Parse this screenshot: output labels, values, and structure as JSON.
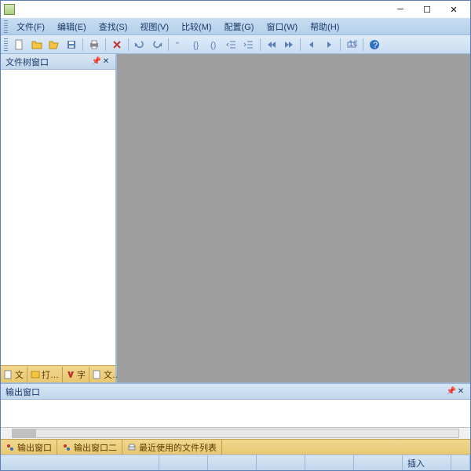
{
  "menus": {
    "file": "文件(F)",
    "edit": "编辑(E)",
    "search": "查找(S)",
    "view": "视图(V)",
    "compare": "比较(M)",
    "config": "配置(G)",
    "window": "窗口(W)",
    "help": "帮助(H)"
  },
  "sidebar": {
    "title": "文件树窗口",
    "tabs": {
      "t1": "文",
      "t2": "打…",
      "t3": "字",
      "t4": "文…"
    }
  },
  "output": {
    "title": "输出窗口",
    "tabs": {
      "t1": "输出窗口",
      "t2": "输出窗口二",
      "t3": "最近使用的文件列表"
    }
  },
  "status": {
    "insert": "插入"
  }
}
